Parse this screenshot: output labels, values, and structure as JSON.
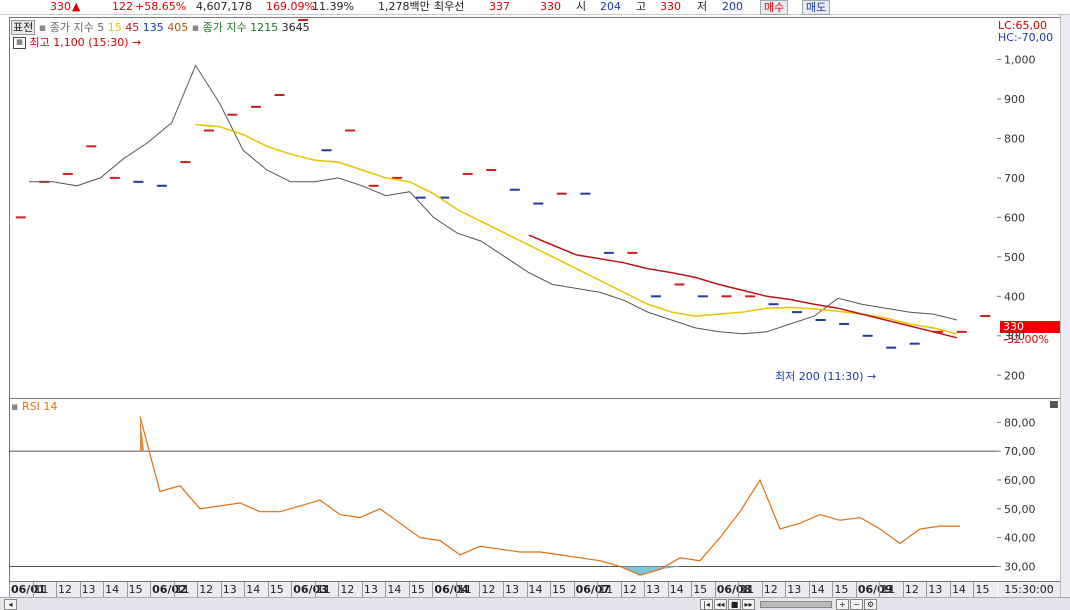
{
  "topbar": {
    "price": "330",
    "arrow": "▲",
    "change": "122",
    "change_pct": "+58.65%",
    "volume": "4,607,178",
    "vol_ratio": "169.09%",
    "turnover": "11.39%",
    "amount": "1,278백만",
    "pref_label": "최우선",
    "bid": "337",
    "ask": "330",
    "open_label": "시",
    "open": "204",
    "high_label": "고",
    "high": "330",
    "low_label": "저",
    "low": "200",
    "buy_label": "매수",
    "sell_label": "매도"
  },
  "main_panel": {
    "tab_label": "표전",
    "ma_title": "종가 지수",
    "ma_periods": [
      "5",
      "15",
      "45",
      "135",
      "405"
    ],
    "ma2_title": "종가 지수",
    "ma2_periods": [
      "1215",
      "3645"
    ],
    "high_marker": "최고 1,100 (15:30)",
    "low_marker": "최저 200 (11:30)",
    "lc": "LC:65,00",
    "hc": "HC:-70,00",
    "current_price": "330",
    "current_pct": "-32.00%"
  },
  "rsi_panel": {
    "title": "RSI 14"
  },
  "x_axis": {
    "labels": [
      {
        "t": "06/01",
        "b": true
      },
      {
        "t": "11"
      },
      {
        "t": "12"
      },
      {
        "t": "13"
      },
      {
        "t": "14"
      },
      {
        "t": "15"
      },
      {
        "t": "06/02",
        "b": true
      },
      {
        "t": "11"
      },
      {
        "t": "12"
      },
      {
        "t": "13"
      },
      {
        "t": "14"
      },
      {
        "t": "15"
      },
      {
        "t": "06/03",
        "b": true
      },
      {
        "t": "11"
      },
      {
        "t": "12"
      },
      {
        "t": "13"
      },
      {
        "t": "14"
      },
      {
        "t": "15"
      },
      {
        "t": "06/04",
        "b": true
      },
      {
        "t": "11"
      },
      {
        "t": "12"
      },
      {
        "t": "13"
      },
      {
        "t": "14"
      },
      {
        "t": "15"
      },
      {
        "t": "06/07",
        "b": true
      },
      {
        "t": "11"
      },
      {
        "t": "12"
      },
      {
        "t": "13"
      },
      {
        "t": "14"
      },
      {
        "t": "15"
      },
      {
        "t": "06/08",
        "b": true
      },
      {
        "t": "11"
      },
      {
        "t": "12"
      },
      {
        "t": "13"
      },
      {
        "t": "14"
      },
      {
        "t": "15"
      },
      {
        "t": "06/09",
        "b": true
      },
      {
        "t": "11"
      },
      {
        "t": "12"
      },
      {
        "t": "13"
      },
      {
        "t": "14"
      },
      {
        "t": "15"
      }
    ],
    "time_label": "15:30:00"
  },
  "colors": {
    "ma5": "#555555",
    "ma15": "#e8c400",
    "ma45": "#c0131a",
    "rsi": "#e07010",
    "up": "#d01c1c",
    "down": "#1e3c9c",
    "rsi_fill": "#7fc6dc"
  },
  "chart_data": [
    {
      "type": "line",
      "title": "",
      "yticks": [
        200,
        300,
        400,
        500,
        600,
        700,
        800,
        900,
        1000
      ],
      "ylim": [
        150,
        1100
      ],
      "x_count": 42,
      "candles": [
        {
          "i": 0,
          "v": 600,
          "d": "up"
        },
        {
          "i": 1,
          "v": 690,
          "d": "up"
        },
        {
          "i": 2,
          "v": 710,
          "d": "up"
        },
        {
          "i": 3,
          "v": 780,
          "d": "up"
        },
        {
          "i": 4,
          "v": 700,
          "d": "up"
        },
        {
          "i": 5,
          "v": 690,
          "d": "down"
        },
        {
          "i": 6,
          "v": 680,
          "d": "down"
        },
        {
          "i": 7,
          "v": 740,
          "d": "up"
        },
        {
          "i": 8,
          "v": 820,
          "d": "up"
        },
        {
          "i": 9,
          "v": 860,
          "d": "up"
        },
        {
          "i": 10,
          "v": 880,
          "d": "up"
        },
        {
          "i": 11,
          "v": 910,
          "d": "up"
        },
        {
          "i": 12,
          "v": 1100,
          "d": "up"
        },
        {
          "i": 13,
          "v": 770,
          "d": "down"
        },
        {
          "i": 14,
          "v": 820,
          "d": "up"
        },
        {
          "i": 15,
          "v": 680,
          "d": "up"
        },
        {
          "i": 16,
          "v": 700,
          "d": "up"
        },
        {
          "i": 17,
          "v": 650,
          "d": "down"
        },
        {
          "i": 18,
          "v": 650,
          "d": "down"
        },
        {
          "i": 19,
          "v": 710,
          "d": "up"
        },
        {
          "i": 20,
          "v": 720,
          "d": "up"
        },
        {
          "i": 21,
          "v": 670,
          "d": "down"
        },
        {
          "i": 22,
          "v": 635,
          "d": "down"
        },
        {
          "i": 23,
          "v": 660,
          "d": "up"
        },
        {
          "i": 24,
          "v": 660,
          "d": "down"
        },
        {
          "i": 25,
          "v": 510,
          "d": "down"
        },
        {
          "i": 26,
          "v": 510,
          "d": "up"
        },
        {
          "i": 27,
          "v": 400,
          "d": "down"
        },
        {
          "i": 28,
          "v": 430,
          "d": "up"
        },
        {
          "i": 29,
          "v": 400,
          "d": "down"
        },
        {
          "i": 30,
          "v": 400,
          "d": "up"
        },
        {
          "i": 31,
          "v": 400,
          "d": "up"
        },
        {
          "i": 32,
          "v": 380,
          "d": "down"
        },
        {
          "i": 33,
          "v": 360,
          "d": "down"
        },
        {
          "i": 34,
          "v": 340,
          "d": "down"
        },
        {
          "i": 35,
          "v": 330,
          "d": "down"
        },
        {
          "i": 36,
          "v": 300,
          "d": "down"
        },
        {
          "i": 37,
          "v": 270,
          "d": "down"
        },
        {
          "i": 38,
          "v": 280,
          "d": "down"
        },
        {
          "i": 39,
          "v": 310,
          "d": "up"
        },
        {
          "i": 40,
          "v": 310,
          "d": "up"
        },
        {
          "i": 41,
          "v": 350,
          "d": "up"
        }
      ],
      "series": [
        {
          "name": "5",
          "values": [
            690,
            690,
            680,
            700,
            750,
            790,
            840,
            985,
            890,
            770,
            720,
            690,
            690,
            700,
            680,
            655,
            665,
            600,
            560,
            540,
            500,
            460,
            430,
            420,
            410,
            390,
            360,
            340,
            320,
            310,
            305,
            310,
            330,
            350,
            395,
            380,
            370,
            360,
            355,
            340
          ]
        },
        {
          "name": "15",
          "values": [
            null,
            null,
            null,
            null,
            null,
            null,
            null,
            835,
            830,
            810,
            780,
            760,
            745,
            740,
            720,
            700,
            690,
            660,
            620,
            590,
            560,
            530,
            500,
            470,
            440,
            410,
            380,
            360,
            350,
            355,
            360,
            370,
            372,
            368,
            362,
            355,
            345,
            330,
            320,
            305
          ]
        },
        {
          "name": "45",
          "values": [
            null,
            null,
            null,
            null,
            null,
            null,
            null,
            null,
            null,
            null,
            null,
            null,
            null,
            null,
            null,
            null,
            null,
            null,
            null,
            null,
            null,
            555,
            530,
            505,
            495,
            485,
            470,
            460,
            448,
            430,
            415,
            400,
            392,
            380,
            370,
            355,
            340,
            325,
            310,
            295
          ]
        }
      ]
    },
    {
      "type": "line",
      "title": "RSI 14",
      "yticks": [
        30,
        40,
        50,
        60,
        70,
        80
      ],
      "ylim": [
        26,
        86
      ],
      "series": [
        {
          "name": "RSI 14",
          "values": [
            82,
            56,
            58,
            50,
            51,
            52,
            49,
            49,
            51,
            53,
            48,
            47,
            50,
            45,
            40,
            39,
            34,
            37,
            36,
            35,
            35,
            34,
            33,
            32,
            30,
            27,
            29,
            33,
            32,
            40,
            49,
            60,
            43,
            45,
            48,
            46,
            47,
            43,
            38,
            43,
            44,
            44
          ]
        }
      ]
    }
  ]
}
